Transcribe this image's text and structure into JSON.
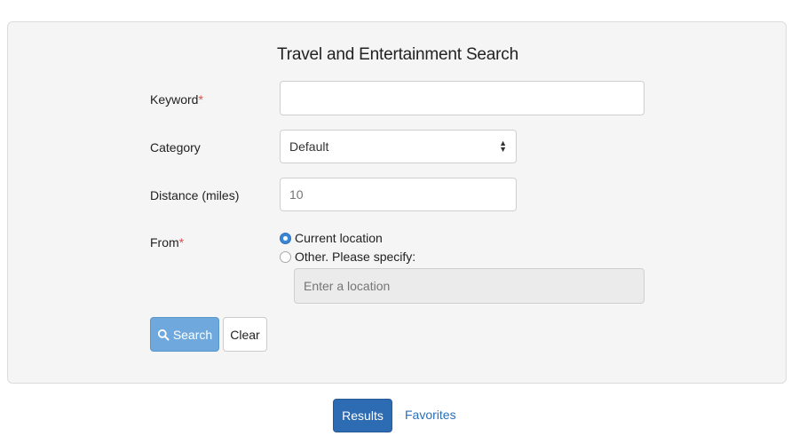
{
  "form": {
    "title": "Travel and Entertainment Search",
    "keyword": {
      "label": "Keyword",
      "required_mark": "*",
      "value": ""
    },
    "category": {
      "label": "Category",
      "selected": "Default"
    },
    "distance": {
      "label": "Distance (miles)",
      "placeholder": "10",
      "value": ""
    },
    "from": {
      "label": "From",
      "required_mark": "*",
      "options": [
        {
          "label": "Current location",
          "checked": true
        },
        {
          "label": "Other. Please specify:",
          "checked": false
        }
      ],
      "location_placeholder": "Enter a location"
    },
    "buttons": {
      "search": "Search",
      "clear": "Clear"
    }
  },
  "tabs": {
    "results": "Results",
    "favorites": "Favorites"
  },
  "colors": {
    "panel_bg": "#f5f5f5",
    "search_button": "#6fa8dc",
    "results_button": "#2d6bb3",
    "link": "#2a6fb8",
    "required": "#d9534f"
  },
  "icons": {
    "search": "search-icon",
    "select": "chevron-updown-icon"
  }
}
